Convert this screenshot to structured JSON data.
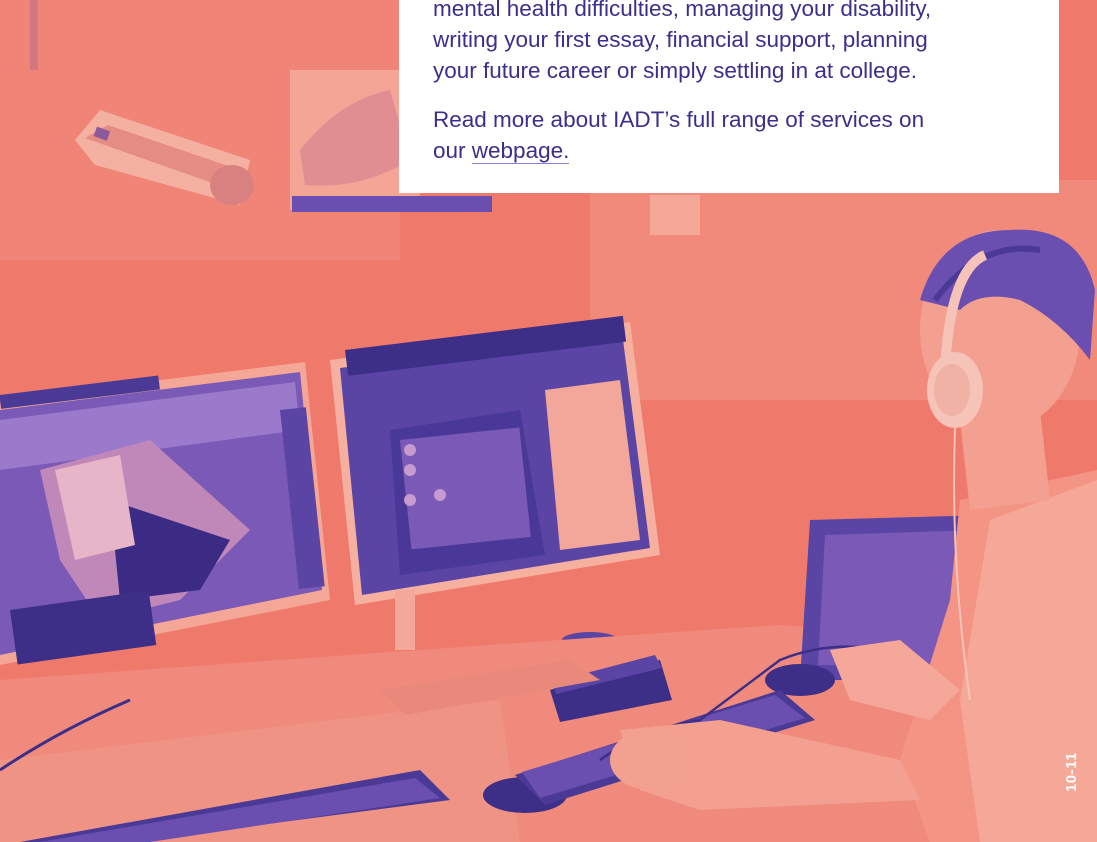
{
  "intro": {
    "line_1": "mental health difficulties, managing your disability,",
    "line_2": "writing your first essay, financial support, planning",
    "line_3": "your future career or simply settling in at college."
  },
  "services": {
    "line_1": "Read more about IADT’s full range of services on",
    "line_2_prefix": "our ",
    "link_text": "webpage."
  },
  "page_number": "10-11",
  "colors": {
    "photo_tint": "#ef7a6c",
    "shadow_tint": "#6a4fb0",
    "text": "#3a2f8a",
    "text_box": "#ffffff"
  },
  "photo": {
    "subject": "student-with-headphones-at-dual-monitors"
  }
}
